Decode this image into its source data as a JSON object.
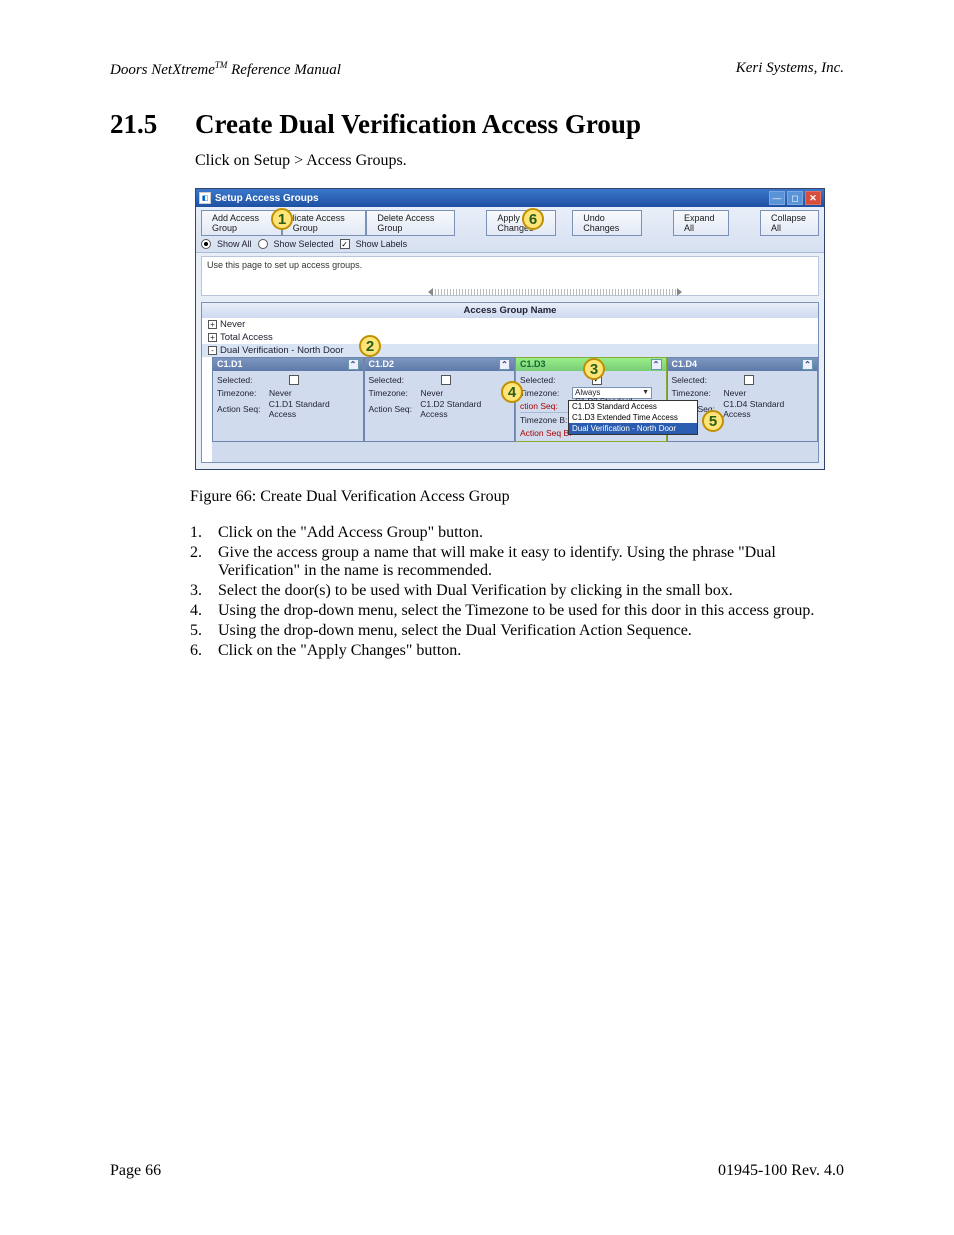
{
  "header": {
    "left_product": "Doors NetXtreme",
    "left_tm": "TM",
    "left_suffix": " Reference Manual",
    "right": "Keri Systems, Inc."
  },
  "section": {
    "number": "21.5",
    "title": "Create Dual Verification Access Group"
  },
  "intro": "Click on Setup > Access Groups.",
  "window": {
    "title": "Setup Access Groups",
    "toolbar_buttons": {
      "add": "Add Access Group",
      "duplicate": "licate Access Group",
      "delete": "Delete Access Group",
      "apply": "Apply Changes",
      "undo": "Undo Changes",
      "expand": "Expand All",
      "collapse": "Collapse All"
    },
    "filters": {
      "show_all": "Show All",
      "show_selected": "Show Selected",
      "show_labels": "Show Labels"
    },
    "info_text": "Use this page to set up access groups.",
    "list_header": "Access Group Name",
    "groups": {
      "never": "Never",
      "total": "Total Access",
      "dual": "Dual Verification - North Door"
    },
    "doors": [
      {
        "name": "C1.D1",
        "selected_lbl": "Selected:",
        "timezone_lbl": "Timezone:",
        "timezone_val": "Never",
        "action_lbl": "Action Seq:",
        "action_val": "C1.D1 Standard Access"
      },
      {
        "name": "C1.D2",
        "selected_lbl": "Selected:",
        "timezone_lbl": "Timezone:",
        "timezone_val": "Never",
        "action_lbl": "Action Seq:",
        "action_val": "C1.D2 Standard Access"
      },
      {
        "name": "C1.D3",
        "selected_lbl": "Selected:",
        "timezone_lbl": "Timezone:",
        "timezone_val": "Always",
        "action_lbl": "ction Seq:",
        "action_val": "C1.D3 Standard Acces",
        "tzb_lbl": "Timezone B:",
        "asb_lbl": "Action Seq B:"
      },
      {
        "name": "C1.D4",
        "selected_lbl": "Selected:",
        "timezone_lbl": "Timezone:",
        "timezone_val": "Never",
        "action_lbl": "Action Seq:",
        "action_val": "C1.D4 Standard Access"
      }
    ],
    "popup_items": {
      "a": "C1.D3 Standard Access",
      "b": "C1.D3 Extended Time Access",
      "c": "Dual Verification - North Door"
    }
  },
  "callouts": {
    "c1": "1",
    "c2": "2",
    "c3": "3",
    "c4": "4",
    "c5": "5",
    "c6": "6"
  },
  "figure_caption": "Figure 66: Create Dual Verification Access Group",
  "steps": [
    "Click on the \"Add Access Group\" button.",
    "Give the access group a name that will make it easy to identify. Using the phrase \"Dual Verification\" in the name is recommended.",
    "Select the door(s) to be used with Dual Verification by clicking in the small box.",
    "Using the drop-down menu, select the Timezone to be used for this door in this access group.",
    "Using the drop-down menu, select the Dual Verification Action Sequence.",
    "Click on the \"Apply Changes\" button."
  ],
  "footer": {
    "left": "Page 66",
    "right": "01945-100  Rev. 4.0"
  }
}
